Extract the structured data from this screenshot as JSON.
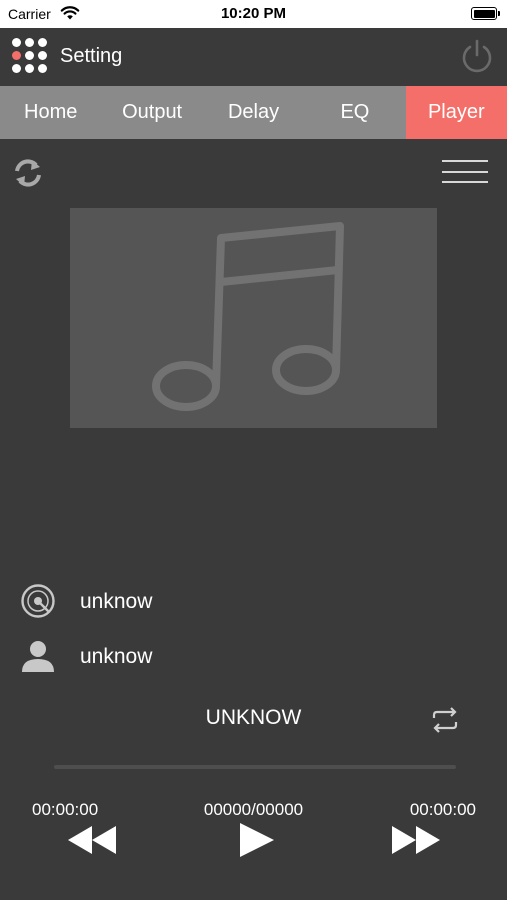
{
  "status_bar": {
    "carrier": "Carrier",
    "time": "10:20 PM"
  },
  "header": {
    "title": "Setting"
  },
  "tabs": [
    {
      "label": "Home",
      "active": false
    },
    {
      "label": "Output",
      "active": false
    },
    {
      "label": "Delay",
      "active": false
    },
    {
      "label": "EQ",
      "active": false
    },
    {
      "label": "Player",
      "active": true
    }
  ],
  "player": {
    "album": "unknow",
    "artist": "unknow",
    "title": "UNKNOW",
    "progress": 0,
    "elapsed": "00:00:00",
    "track_counter": "00000/00000",
    "duration": "00:00:00"
  },
  "colors": {
    "background": "#3a3a3a",
    "tab_bar": "#8a8a8a",
    "accent": "#f46e6a",
    "artwork_bg": "#555555",
    "icon_muted": "#b0b0b0"
  },
  "icons": {
    "menu": "grid-dots-icon",
    "power": "power-icon",
    "refresh": "refresh-icon",
    "list": "hamburger-icon",
    "artwork": "music-note-icon",
    "album": "disc-icon",
    "artist": "person-icon",
    "repeat": "repeat-icon",
    "prev": "rewind-icon",
    "play": "play-icon",
    "next": "fast-forward-icon"
  }
}
